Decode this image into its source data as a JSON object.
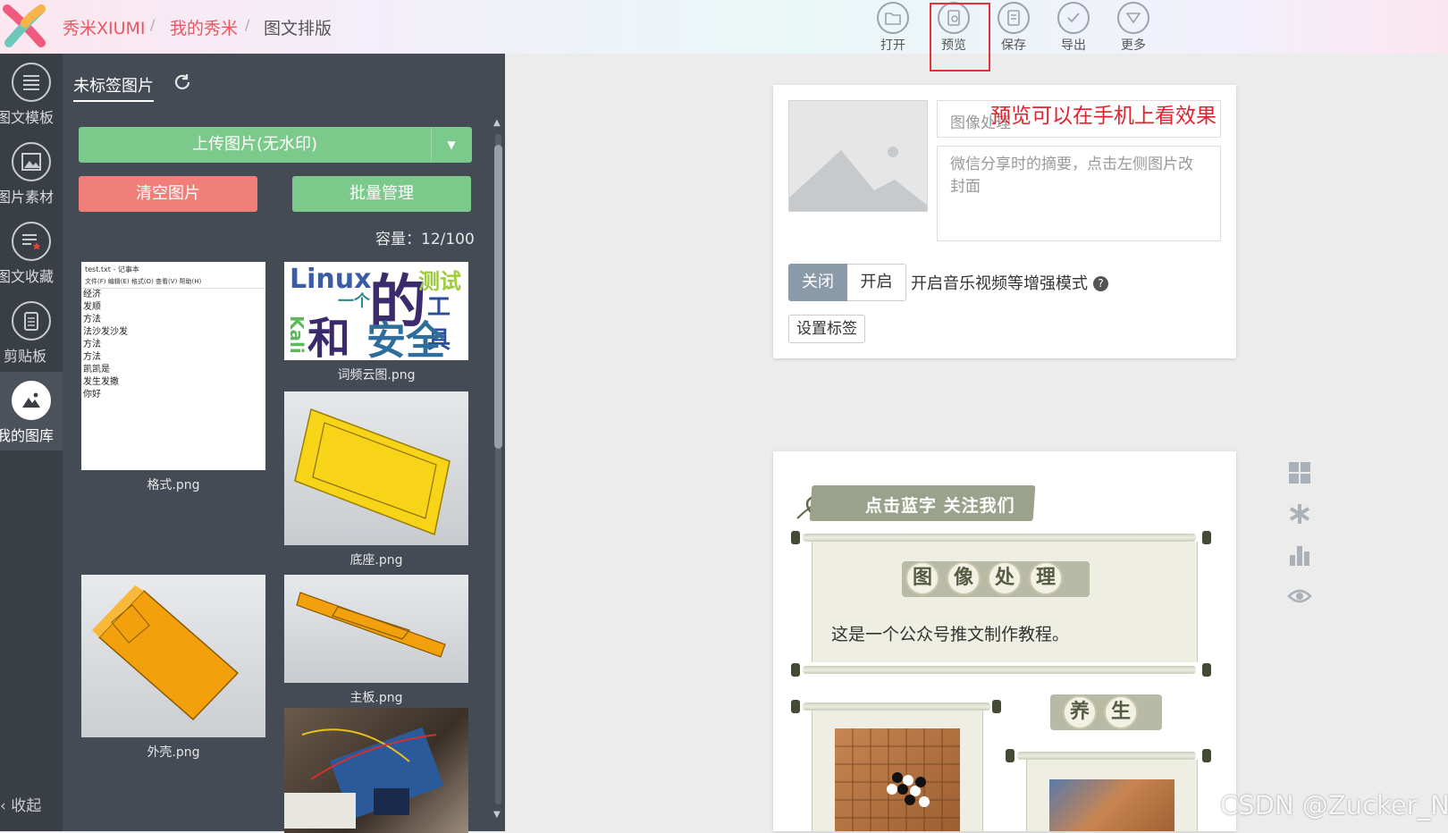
{
  "header": {
    "logo": "xiumi-logo",
    "breadcrumb": [
      {
        "label": "秀米XIUMI"
      },
      {
        "label": "我的秀米"
      },
      {
        "label": "图文排版"
      }
    ],
    "separator": "/",
    "tools": [
      {
        "label": "打开",
        "icon": "folder-open-icon"
      },
      {
        "label": "预览",
        "icon": "preview-phone-icon"
      },
      {
        "label": "保存",
        "icon": "save-icon"
      },
      {
        "label": "导出",
        "icon": "check-export-icon"
      },
      {
        "label": "更多",
        "icon": "chevron-down-icon"
      }
    ]
  },
  "sidebar": {
    "items": [
      {
        "label": "图文模板",
        "icon": "list-icon"
      },
      {
        "label": "图片素材",
        "icon": "image-icon"
      },
      {
        "label": "图文收藏",
        "icon": "star-list-icon"
      },
      {
        "label": "剪贴板",
        "icon": "clipboard-icon"
      },
      {
        "label": "我的图库",
        "icon": "mountain-icon",
        "active": true
      }
    ],
    "collapse_label": "收起"
  },
  "gallery": {
    "tab_label": "未标签图片",
    "upload_label": "上传图片(无水印)",
    "clear_label": "清空图片",
    "batch_label": "批量管理",
    "capacity": "容量：12/100",
    "notepad_title": "test.txt - 记事本",
    "notepad_menu": "文件(F)  编辑(E)  格式(O)  查看(V)  帮助(H)",
    "notepad_lines": [
      "经济",
      "发顺",
      "方法",
      "法沙发沙发",
      "方法",
      "方法",
      "凯凯是",
      "发生发撒",
      "你好"
    ],
    "wordcloud_words": [
      "Linux",
      "的",
      "测试",
      "一个",
      "工具",
      "和",
      "安全",
      "Kali"
    ],
    "images": [
      {
        "name": "格式.png"
      },
      {
        "name": "词频云图.png"
      },
      {
        "name": "底座.png"
      },
      {
        "name": "外壳.png"
      },
      {
        "name": "主板.png"
      }
    ]
  },
  "editor": {
    "title_placeholder": "图像处理",
    "annotation": "预览可以在手机上看效果",
    "summary_placeholder": "微信分享时的摘要，点击左侧图片改封面",
    "toggle_off": "关闭",
    "toggle_on": "开启",
    "enhance_label": "开启音乐视频等增强模式",
    "help_icon": "?",
    "tags_button": "设置标签",
    "content": {
      "follow_banner": "点击蓝字 关注我们",
      "heading_chars": [
        "图",
        "像",
        "处",
        "理"
      ],
      "body_text": "这是一个公众号推文制作教程。",
      "subheading_chars": [
        "养",
        "生"
      ]
    }
  },
  "right_tools": [
    "grid-icon",
    "snowflake-icon",
    "bar-chart-icon",
    "eye-icon"
  ],
  "watermark": "CSDN @Zucker_N",
  "colors": {
    "brand_red": "#e8585e",
    "green_button": "#7cc98c",
    "red_button": "#ef7f78",
    "panel_bg": "#454b54",
    "annotation_red": "#e0232e"
  }
}
